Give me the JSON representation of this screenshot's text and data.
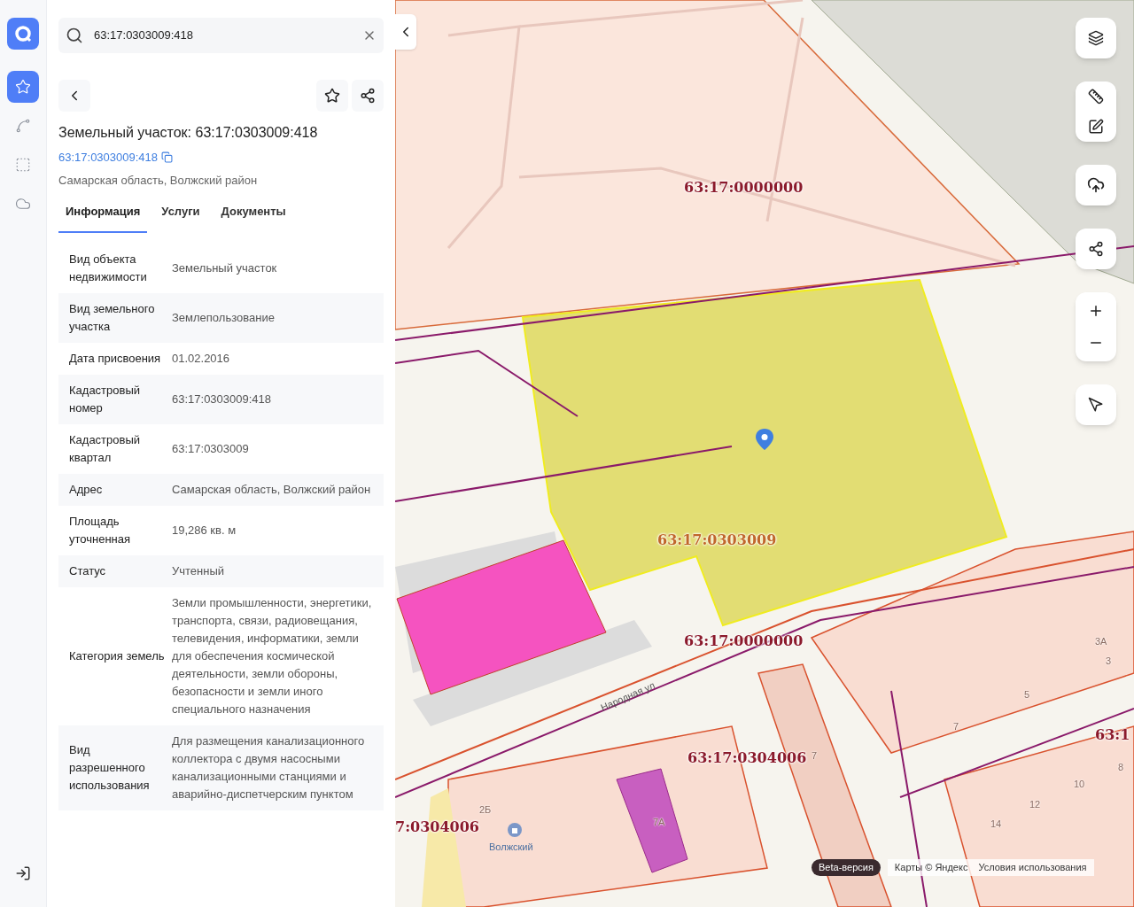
{
  "nav_rail": [
    {
      "selected": true
    },
    {
      "selected": false
    },
    {
      "selected": false
    },
    {
      "selected": false
    }
  ],
  "search": {
    "value": "63:17:0303009:418"
  },
  "object": {
    "title": "Земельный участок: 63:17:0303009:418",
    "cadastral_link": "63:17:0303009:418",
    "region": "Самарская область, Волжский район"
  },
  "tabs": [
    {
      "label": "Информация",
      "selected": true
    },
    {
      "label": "Услуги",
      "selected": false
    },
    {
      "label": "Документы",
      "selected": false
    }
  ],
  "properties": [
    {
      "label": "Вид объекта недвижимости",
      "value": "Земельный участок"
    },
    {
      "label": "Вид земельного участка",
      "value": "Землепользование"
    },
    {
      "label": "Дата присвоения",
      "value": "01.02.2016"
    },
    {
      "label": "Кадастровый номер",
      "value": "63:17:0303009:418"
    },
    {
      "label": "Кадастровый квартал",
      "value": "63:17:0303009"
    },
    {
      "label": "Адрес",
      "value": "Самарская область, Волжский район"
    },
    {
      "label": "Площадь уточненная",
      "value": "19,286 кв. м"
    },
    {
      "label": "Статус",
      "value": "Учтенный"
    },
    {
      "label": "Категория земель",
      "value": "Земли промышленности, энергетики, транспорта, связи, радиовещания, телевидения, информатики, земли для обеспечения космической деятельности, земли обороны, безопасности и земли иного специального назначения"
    },
    {
      "label": "Вид разрешенного использования",
      "value": "Для размещения канализационного коллектора с двумя насосными канализационными станциями и аварийно-диспетчерским пунктом"
    }
  ],
  "map": {
    "labels": [
      {
        "text": "63:17:0000000",
        "kind": "quarter"
      },
      {
        "text": "63:17:0303009",
        "kind": "selected_quarter"
      },
      {
        "text": "63:17:0000000",
        "kind": "quarter"
      },
      {
        "text": "3А",
        "kind": "house"
      },
      {
        "text": "3",
        "kind": "house"
      },
      {
        "text": "5",
        "kind": "house"
      },
      {
        "text": "Народная ул",
        "kind": "street"
      },
      {
        "text": "7",
        "kind": "house"
      },
      {
        "text": "63:1",
        "kind": "quarter"
      },
      {
        "text": "63:17:0304006",
        "kind": "quarter"
      },
      {
        "text": "7",
        "kind": "house"
      },
      {
        "text": "8",
        "kind": "house"
      },
      {
        "text": "10",
        "kind": "house"
      },
      {
        "text": "12",
        "kind": "house"
      },
      {
        "text": "2Б",
        "kind": "house"
      },
      {
        "text": "7:0304006",
        "kind": "quarter"
      },
      {
        "text": "7А",
        "kind": "house"
      },
      {
        "text": "14",
        "kind": "house"
      },
      {
        "text": "Волжский",
        "kind": "poi"
      }
    ],
    "beta": "Beta-версия",
    "attribution": "Карты © Яндекс",
    "terms": "Условия использования"
  }
}
